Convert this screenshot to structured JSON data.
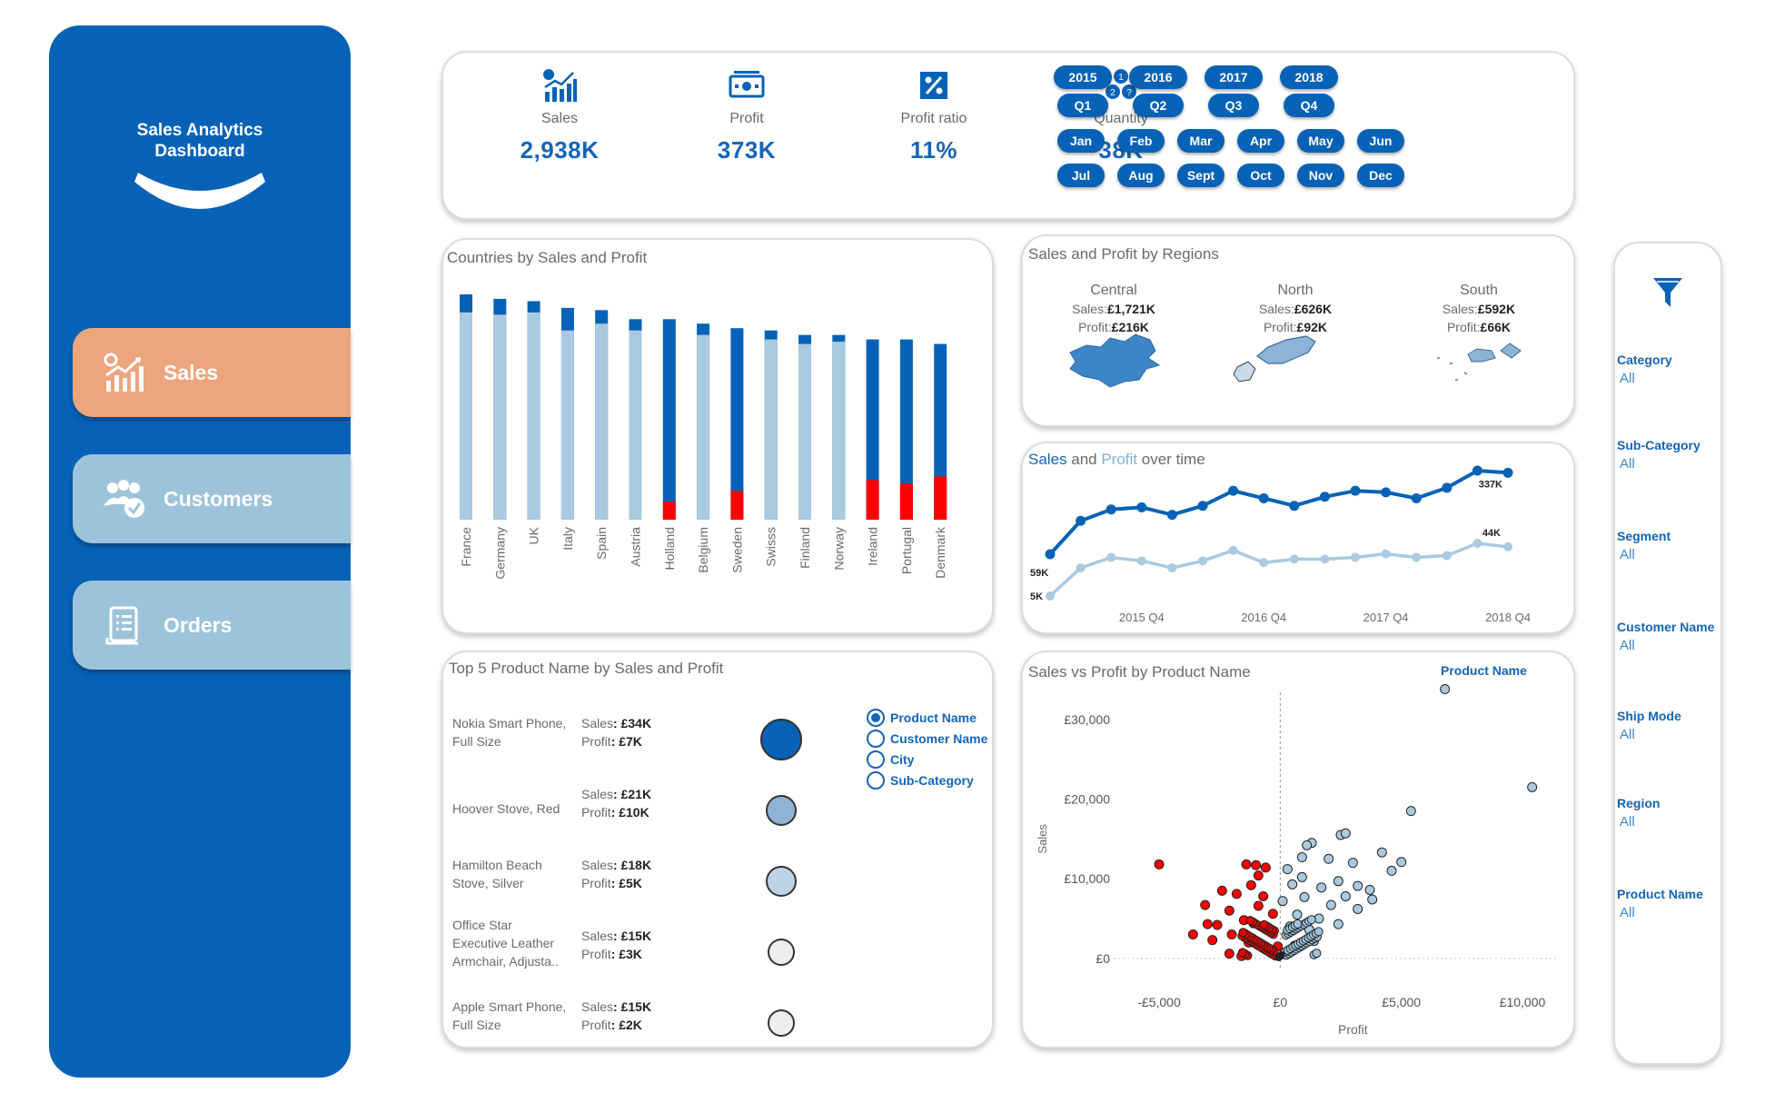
{
  "sidebar": {
    "title_line1": "Sales Analytics",
    "title_line2": "Dashboard",
    "nav": [
      {
        "label": "Sales",
        "icon": "sales-chart-icon"
      },
      {
        "label": "Customers",
        "icon": "customers-icon"
      },
      {
        "label": "Orders",
        "icon": "orders-document-icon"
      }
    ]
  },
  "kpis": [
    {
      "label": "Sales",
      "value": "2,938K",
      "icon": "sales-chart-icon"
    },
    {
      "label": "Profit",
      "value": "373K",
      "icon": "money-icon"
    },
    {
      "label": "Profit ratio",
      "value": "11%",
      "icon": "percent-icon"
    },
    {
      "label": "Quantity",
      "value": "38K",
      "icon": "quantity-icon"
    }
  ],
  "date_filters": {
    "years": [
      "2015",
      "2016",
      "2017",
      "2018"
    ],
    "quarters": [
      "Q1",
      "Q2",
      "Q3",
      "Q4"
    ],
    "months": [
      "Jan",
      "Feb",
      "Mar",
      "Apr",
      "May",
      "Jun",
      "Jul",
      "Aug",
      "Sept",
      "Oct",
      "Nov",
      "Dec"
    ]
  },
  "countries_panel": {
    "title": "Countries by Sales and Profit"
  },
  "regions_panel": {
    "title": "Sales and Profit by Regions",
    "regions": [
      {
        "name": "Central",
        "sales_label": "Sales:",
        "sales": "£1,721K",
        "profit_label": "Profit:",
        "profit": "£216K"
      },
      {
        "name": "North",
        "sales_label": "Sales:",
        "sales": "£626K",
        "profit_label": "Profit:",
        "profit": "£92K"
      },
      {
        "name": "South",
        "sales_label": "Sales:",
        "sales": "£592K",
        "profit_label": "Profit:",
        "profit": "£66K"
      }
    ]
  },
  "time_panel": {
    "title_sales": "Sales",
    "title_and": " and ",
    "title_profit": "Profit",
    "title_rest": " over time"
  },
  "top5_panel": {
    "title": "Top 5 Product Name by Sales and Profit",
    "items": [
      {
        "name_lines": [
          "Nokia Smart Phone,",
          "Full Size"
        ],
        "sales_label": "Sales",
        "sales": ": £34K",
        "profit_label": "Profit",
        "profit": ": £7K",
        "color": "#0562b7"
      },
      {
        "name_lines": [
          "Hoover Stove, Red"
        ],
        "sales_label": "Sales",
        "sales": ": £21K",
        "profit_label": "Profit",
        "profit": ": £10K",
        "color": "#8db3d6"
      },
      {
        "name_lines": [
          "Hamilton Beach",
          "Stove, Silver"
        ],
        "sales_label": "Sales",
        "sales": ": £18K",
        "profit_label": "Profit",
        "profit": ": £5K",
        "color": "#bed3e6"
      },
      {
        "name_lines": [
          "Office Star",
          "Executive Leather",
          "Armchair, Adjusta.."
        ],
        "sales_label": "Sales",
        "sales": ": £15K",
        "profit_label": "Profit",
        "profit": ": £3K",
        "color": "#eeeeee"
      },
      {
        "name_lines": [
          "Apple Smart Phone,",
          "Full Size"
        ],
        "sales_label": "Sales",
        "sales": ": £15K",
        "profit_label": "Profit",
        "profit": ": £2K",
        "color": "#eeeeee"
      }
    ],
    "options": [
      "Product Name",
      "Customer Name",
      "City",
      "Sub-Category"
    ],
    "selected_option": "Product Name"
  },
  "scatter_panel": {
    "title": "Sales vs Profit by Product Name",
    "legend_title": "Product Name"
  },
  "filters": [
    {
      "label": "Category",
      "value": "All"
    },
    {
      "label": "Sub-Category",
      "value": "All"
    },
    {
      "label": "Segment",
      "value": "All"
    },
    {
      "label": "Customer Name",
      "value": "All"
    },
    {
      "label": "Ship Mode",
      "value": "All"
    },
    {
      "label": "Region",
      "value": "All"
    },
    {
      "label": "Product Name",
      "value": "All"
    }
  ],
  "colors": {
    "brand_blue": "#0562b7",
    "light_blue": "#9dc3da",
    "sales_orange": "#eda57e",
    "loss_red": "#ff0000",
    "profit_light": "#a9cae0"
  },
  "chart_data": [
    {
      "type": "bar",
      "title": "Countries by Sales and Profit",
      "categories": [
        "France",
        "Germany",
        "UK",
        "Italy",
        "Spain",
        "Austria",
        "Holland",
        "Belgium",
        "Sweden",
        "Swisss",
        "Finland",
        "Norway",
        "Ireland",
        "Portugal",
        "Denmark"
      ],
      "series": [
        {
          "values": [
            100,
            98,
            97,
            94,
            93,
            89,
            89,
            87,
            85,
            84,
            82,
            82,
            80,
            80,
            78
          ]
        },
        {
          "values": [
            92,
            91,
            92,
            84,
            87,
            84,
            -5,
            82,
            -8,
            80,
            78,
            79,
            -11,
            -10,
            -12
          ]
        }
      ]
    },
    {
      "type": "line",
      "title": "Sales and Profit over time",
      "x": [
        "2015 Q1",
        "2015 Q2",
        "2015 Q3",
        "2015 Q4",
        "2016 Q1",
        "2016 Q2",
        "2016 Q3",
        "2016 Q4",
        "2017 Q1",
        "2017 Q2",
        "2017 Q3",
        "2017 Q4",
        "2018 Q1",
        "2018 Q2",
        "2018 Q3",
        "2018 Q4"
      ],
      "xticks": [
        "2015 Q4",
        "2016 Q4",
        "2017 Q4",
        "2018 Q4"
      ],
      "series": [
        {
          "name": "Sales",
          "values": [
            59,
            170,
            208,
            215,
            190,
            220,
            270,
            245,
            220,
            250,
            270,
            265,
            245,
            280,
            337,
            330
          ],
          "first_label": "59K",
          "last_label": "337K"
        },
        {
          "name": "Profit",
          "values": [
            5,
            21,
            27,
            25,
            21,
            25,
            31,
            24,
            26,
            26,
            27,
            29,
            27,
            28,
            35,
            33
          ],
          "first_label": "5K",
          "last_label": "44K"
        }
      ]
    },
    {
      "type": "scatter",
      "title": "Sales vs Profit by Product Name",
      "xlabel": "Profit",
      "ylabel": "Sales",
      "xlim": [
        -6500,
        11500
      ],
      "ylim": [
        -1500,
        35000
      ],
      "xticks": [
        -5000,
        0,
        5000,
        10000
      ],
      "xtick_labels": [
        "-£5,000",
        "£0",
        "£5,000",
        "£10,000"
      ],
      "yticks": [
        0,
        10000,
        20000,
        30000
      ],
      "ytick_labels": [
        "£0",
        "£10,000",
        "£20,000",
        "£30,000"
      ],
      "points": [
        [
          6800,
          33800
        ],
        [
          10400,
          21500
        ],
        [
          5400,
          18500
        ],
        [
          -5000,
          11800
        ],
        [
          -1400,
          11800
        ],
        [
          -1000,
          11700
        ],
        [
          2500,
          15500
        ],
        [
          2700,
          15700
        ],
        [
          1300,
          14500
        ],
        [
          1100,
          14200
        ],
        [
          4200,
          13300
        ],
        [
          5000,
          12100
        ],
        [
          4600,
          11000
        ],
        [
          3000,
          12000
        ],
        [
          2000,
          12500
        ],
        [
          900,
          12700
        ],
        [
          300,
          11200
        ],
        [
          -600,
          11400
        ],
        [
          -900,
          10400
        ],
        [
          -1200,
          9200
        ],
        [
          -1800,
          8100
        ],
        [
          -2400,
          8500
        ],
        [
          -3100,
          6700
        ],
        [
          -2100,
          6000
        ],
        [
          -1500,
          4800
        ],
        [
          -2600,
          4200
        ],
        [
          -2000,
          3000
        ],
        [
          -1300,
          2000
        ],
        [
          -2100,
          600
        ],
        [
          -1600,
          300
        ],
        [
          -3000,
          4300
        ],
        [
          -3600,
          3000
        ],
        [
          -2800,
          2300
        ],
        [
          -900,
          6600
        ],
        [
          -700,
          7800
        ],
        [
          -400,
          3600
        ],
        [
          -100,
          1500
        ],
        [
          -400,
          800
        ],
        [
          200,
          500
        ],
        [
          600,
          1600
        ],
        [
          1200,
          3600
        ],
        [
          1600,
          5000
        ],
        [
          2100,
          6700
        ],
        [
          2700,
          7800
        ],
        [
          3200,
          9100
        ],
        [
          3700,
          8600
        ],
        [
          2400,
          9700
        ],
        [
          1700,
          8900
        ],
        [
          1000,
          7700
        ],
        [
          700,
          5500
        ],
        [
          400,
          4000
        ],
        [
          1400,
          2200
        ],
        [
          2400,
          4300
        ],
        [
          3200,
          6200
        ],
        [
          3800,
          7400
        ],
        [
          500,
          9300
        ],
        [
          900,
          10200
        ],
        [
          100,
          7200
        ],
        [
          -300,
          5600
        ],
        [
          -1100,
          4400
        ]
      ]
    }
  ]
}
